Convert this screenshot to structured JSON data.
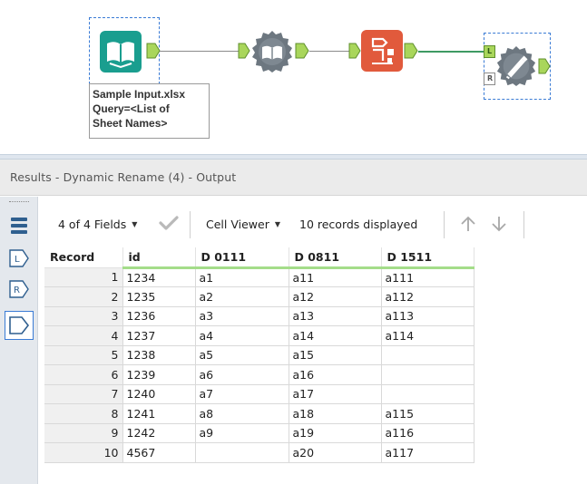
{
  "canvas": {
    "input_tool_annotation": "Sample Input.xlsx\nQuery=<List of\nSheet Names>",
    "anchors": {
      "left": "L",
      "right": "R"
    },
    "colors": {
      "input": "#1a9e8f",
      "macro": "#6d7780",
      "rename": "#e15a3c",
      "output": "#6d7780",
      "connector": "#8a8a8a",
      "connector_active": "#3e9a63",
      "anchor": "#a9d65b"
    }
  },
  "results": {
    "title": "Results - Dynamic Rename (4) - Output",
    "toolbar": {
      "fields": "4 of 4 Fields",
      "viewer": "Cell Viewer",
      "records": "10 records displayed"
    },
    "rail": {
      "icons": [
        "list-icon",
        "left-anchor-icon",
        "right-anchor-icon",
        "output-anchor-icon"
      ],
      "left_label": "L",
      "right_label": "R"
    },
    "table": {
      "columns": [
        "Record",
        "id",
        "D 0111",
        "D 0811",
        "D 1511"
      ],
      "rows": [
        [
          "1",
          "1234",
          "a1",
          "a11",
          "a111"
        ],
        [
          "2",
          "1235",
          "a2",
          "a12",
          "a112"
        ],
        [
          "3",
          "1236",
          "a3",
          "a13",
          "a113"
        ],
        [
          "4",
          "1237",
          "a4",
          "a14",
          "a114"
        ],
        [
          "5",
          "1238",
          "a5",
          "a15",
          ""
        ],
        [
          "6",
          "1239",
          "a6",
          "a16",
          ""
        ],
        [
          "7",
          "1240",
          "a7",
          "a17",
          ""
        ],
        [
          "8",
          "1241",
          "a8",
          "a18",
          "a115"
        ],
        [
          "9",
          "1242",
          "a9",
          "a19",
          "a116"
        ],
        [
          "10",
          "4567",
          "",
          "a20",
          "a117"
        ]
      ]
    }
  }
}
